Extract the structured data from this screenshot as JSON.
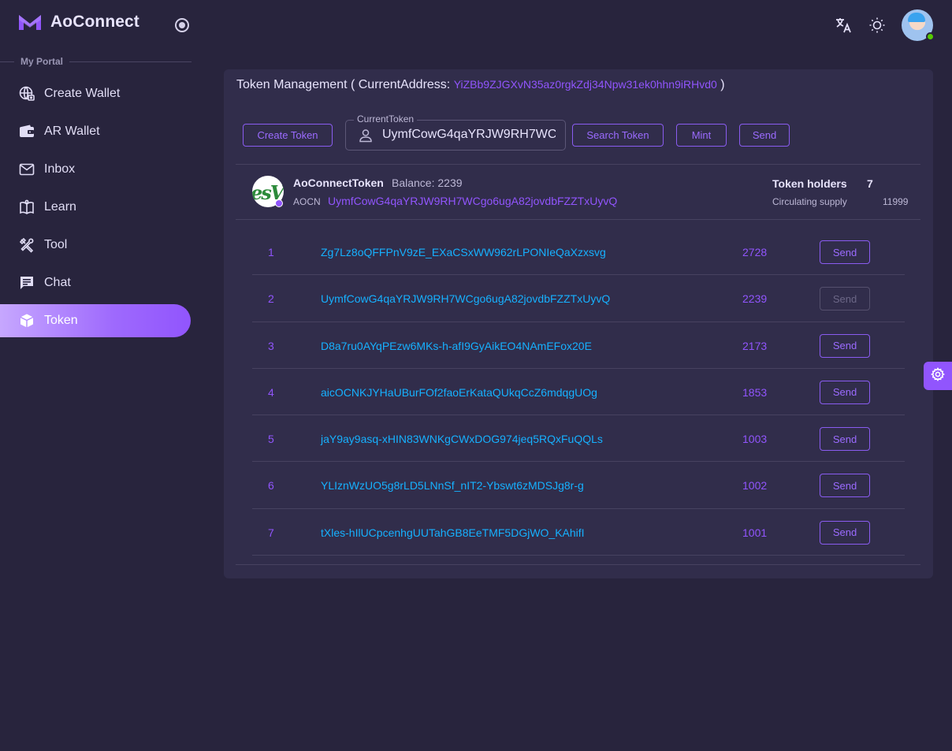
{
  "app": {
    "name": "AoConnect"
  },
  "sidebar": {
    "section_label": "My Portal",
    "items": [
      {
        "label": "Create Wallet",
        "icon": "wallet-plus-icon"
      },
      {
        "label": "AR Wallet",
        "icon": "wallet-icon"
      },
      {
        "label": "Inbox",
        "icon": "mail-icon"
      },
      {
        "label": "Learn",
        "icon": "book-icon"
      },
      {
        "label": "Tool",
        "icon": "tools-icon"
      },
      {
        "label": "Chat",
        "icon": "chat-icon"
      },
      {
        "label": "Token",
        "icon": "cube-icon",
        "active": true
      }
    ]
  },
  "header": {
    "title_prefix": "Token Management ( CurrentAddress: ",
    "current_address": "YiZBb9ZJGXvN35az0rgkZdj34Npw31ek0hhn9iRHvd0",
    "title_suffix": " )"
  },
  "toolbar": {
    "create_token_label": "Create Token",
    "current_token_label": "CurrentToken",
    "current_token_value": "UymfCowG4qaYRJW9RH7WCgo6ugA82jovdbFZZTxUyvQ",
    "search_token_label": "Search Token",
    "mint_label": "Mint",
    "send_label": "Send"
  },
  "token": {
    "name": "AoConnectToken",
    "balance": "Balance: 2239",
    "symbol": "AOCN",
    "address": "UymfCowG4qaYRJW9RH7WCgo6ugA82jovdbFZZTxUyvQ",
    "holders_label": "Token holders",
    "holders_value": "7",
    "supply_label": "Circulating supply",
    "supply_value": "11999"
  },
  "holders": [
    {
      "index": "1",
      "address": "Zg7Lz8oQFFPnV9zE_EXaCSxWW962rLPONIeQaXzxsvg",
      "amount": "2728",
      "action": "Send",
      "disabled": false
    },
    {
      "index": "2",
      "address": "UymfCowG4qaYRJW9RH7WCgo6ugA82jovdbFZZTxUyvQ",
      "amount": "2239",
      "action": "Send",
      "disabled": true
    },
    {
      "index": "3",
      "address": "D8a7ru0AYqPEzw6MKs-h-afI9GyAikEO4NAmEFox20E",
      "amount": "2173",
      "action": "Send",
      "disabled": false
    },
    {
      "index": "4",
      "address": "aicOCNKJYHaUBurFOf2faoErKataQUkqCcZ6mdqgUOg",
      "amount": "1853",
      "action": "Send",
      "disabled": false
    },
    {
      "index": "5",
      "address": "jaY9ay9asq-xHIN83WNKgCWxDOG974jeq5RQxFuQQLs",
      "amount": "1003",
      "action": "Send",
      "disabled": false
    },
    {
      "index": "6",
      "address": "YLIznWzUO5g8rLD5LNnSf_nIT2-Ybswt6zMDSJg8r-g",
      "amount": "1002",
      "action": "Send",
      "disabled": false
    },
    {
      "index": "7",
      "address": "tXles-hIlUCpcenhgUUTahGB8EeTMF5DGjWO_KAhifI",
      "amount": "1001",
      "action": "Send",
      "disabled": false
    }
  ],
  "colors": {
    "accent": "#9155fd",
    "link": "#16b1ff",
    "background": "#28243d",
    "card": "#312d4b"
  }
}
